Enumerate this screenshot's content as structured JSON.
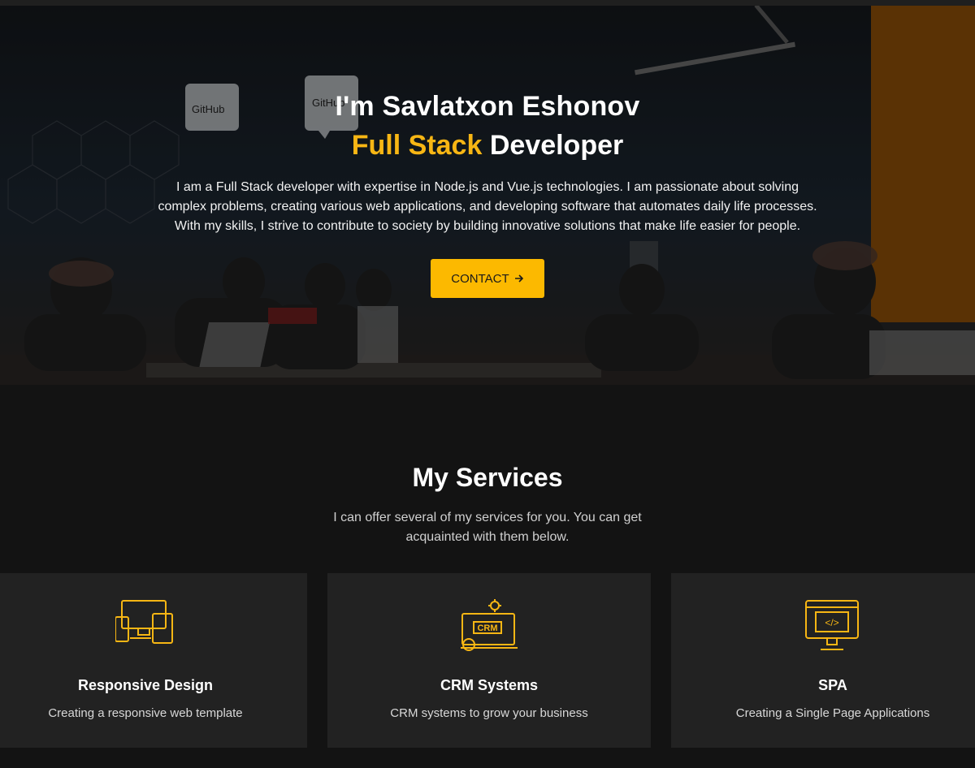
{
  "hero": {
    "title": "I'm Savlatxon Eshonov",
    "role_accent": "Full Stack",
    "role_rest": "Developer",
    "description": "I am a Full Stack developer with expertise in Node.js and Vue.js technologies. I am passionate about solving complex problems, creating various web applications, and developing software that automates daily life processes. With my skills, I strive to contribute to society by building innovative solutions that make life easier for people.",
    "contact_label": "CONTACT",
    "contact_icon": "arrow-right-icon",
    "background_signs": [
      "GitHub",
      "GitHub"
    ],
    "accent_color": "#fcb900"
  },
  "services": {
    "title": "My Services",
    "subtitle": "I can offer several of my services for you. You can get acquainted with them below.",
    "cards": [
      {
        "icon": "responsive-devices-icon",
        "title": "Responsive Design",
        "desc": "Creating a responsive web template"
      },
      {
        "icon": "crm-icon",
        "icon_text": "CRM",
        "title": "CRM Systems",
        "desc": "CRM systems to grow your business"
      },
      {
        "icon": "code-monitor-icon",
        "icon_text": "</>",
        "title": "SPA",
        "desc": "Creating a Single Page Applications"
      }
    ]
  }
}
